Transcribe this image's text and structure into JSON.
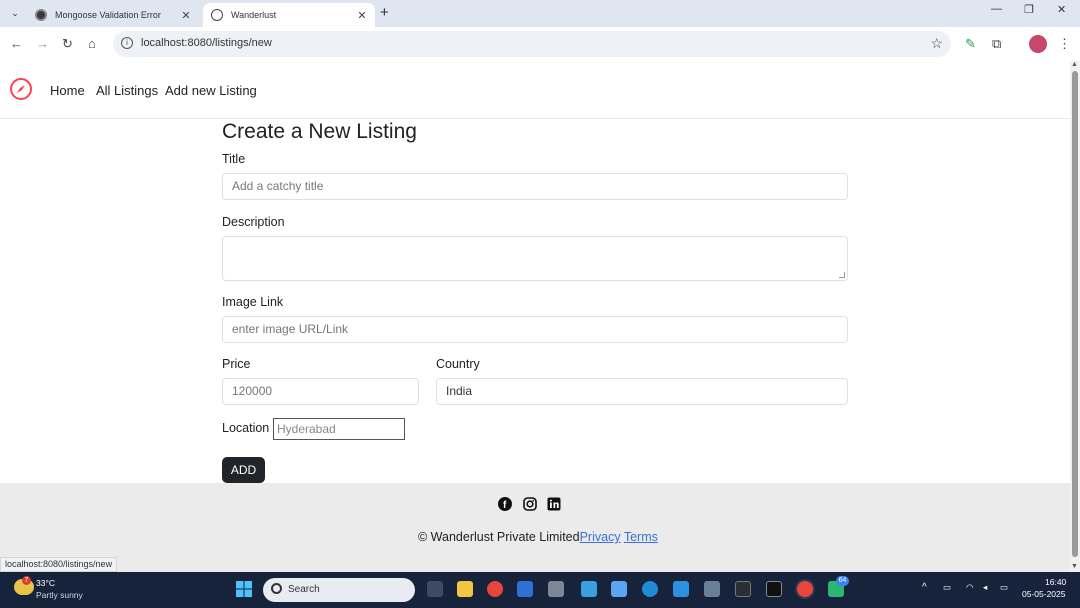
{
  "browser": {
    "tabs": [
      {
        "title": "Mongoose Validation Error"
      },
      {
        "title": "Wanderlust"
      }
    ],
    "url": "localhost:8080/listings/new",
    "status_url": "localhost:8080/listings/new"
  },
  "site": {
    "nav": {
      "home": "Home",
      "all_listings": "All Listings",
      "add_new_listing": "Add new Listing"
    }
  },
  "form": {
    "heading": "Create a New Listing",
    "title_label": "Title",
    "title_placeholder": "Add a catchy title",
    "description_label": "Description",
    "image_label": "Image Link",
    "image_placeholder": "enter image URL/Link",
    "price_label": "Price",
    "price_value": "120000",
    "country_label": "Country",
    "country_value": "India",
    "location_label": "Location",
    "location_value": "Hyderabad",
    "submit_label": "ADD"
  },
  "footer": {
    "copyright": "© Wanderlust Private Limited",
    "privacy": "Privacy",
    "terms": "Terms"
  },
  "taskbar": {
    "weather_temp": "33°C",
    "weather_desc": "Partly sunny",
    "weather_badge": "7",
    "search_label": "Search",
    "time": "16:40",
    "date": "05-05-2025",
    "badge": "64"
  },
  "colors": {
    "brand": "#fe424d",
    "button": "#212529",
    "link": "#3b6fd6"
  }
}
